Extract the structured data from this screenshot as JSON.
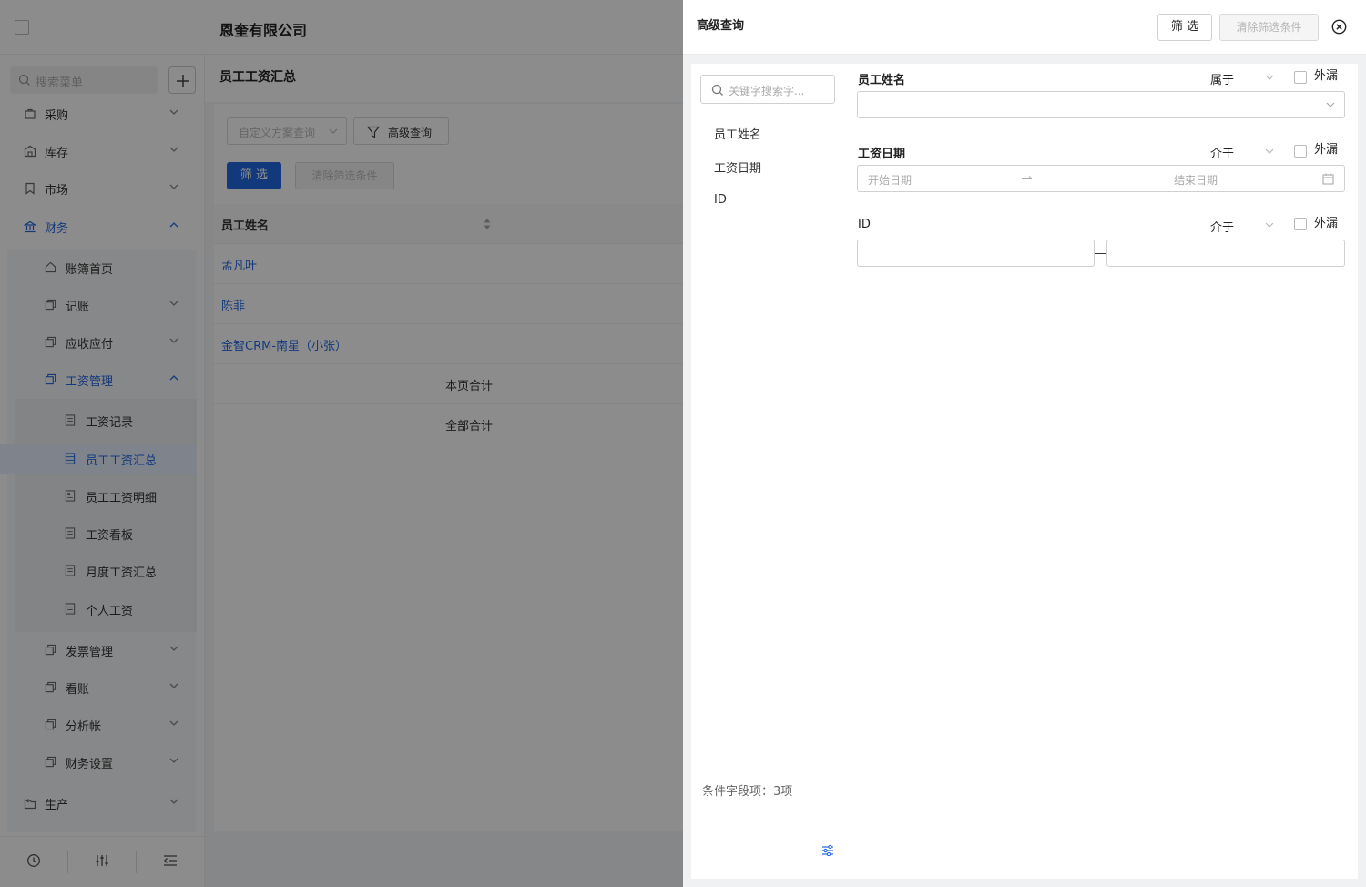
{
  "header": {
    "company": "恩奎有限公司"
  },
  "sidebar": {
    "search_placeholder": "搜索菜单",
    "items": [
      {
        "label": "采购"
      },
      {
        "label": "库存"
      },
      {
        "label": "市场"
      },
      {
        "label": "财务"
      },
      {
        "label": "账簿首页"
      },
      {
        "label": "记账"
      },
      {
        "label": "应收应付"
      },
      {
        "label": "工资管理"
      },
      {
        "label": "工资记录"
      },
      {
        "label": "员工工资汇总"
      },
      {
        "label": "员工工资明细"
      },
      {
        "label": "工资看板"
      },
      {
        "label": "月度工资汇总"
      },
      {
        "label": "个人工资"
      },
      {
        "label": "发票管理"
      },
      {
        "label": "看账"
      },
      {
        "label": "分析帐"
      },
      {
        "label": "财务设置"
      },
      {
        "label": "生产"
      }
    ]
  },
  "content": {
    "title": "员工工资汇总",
    "scheme_placeholder": "自定义方案查询",
    "advanced_query_label": "高级查询",
    "filter_label": "筛 选",
    "clear_label": "清除筛选条件",
    "table": {
      "header": "员工姓名",
      "rows": [
        "孟凡叶",
        "陈菲",
        "金智CRM-南星（小张）"
      ],
      "page_total": "本页合计",
      "all_total": "全部合计"
    }
  },
  "drawer": {
    "title": "高级查询",
    "filter_label": "筛 选",
    "clear_label": "清除筛选条件",
    "search_placeholder": "关键字搜索字...",
    "fields": [
      "员工姓名",
      "工资日期",
      "ID"
    ],
    "conditions": [
      {
        "label": "员工姓名",
        "operator": "属于",
        "exclude_label": "外漏"
      },
      {
        "label": "工资日期",
        "operator": "介于",
        "exclude_label": "外漏",
        "start_placeholder": "开始日期",
        "end_placeholder": "结束日期"
      },
      {
        "label": "ID",
        "operator": "介于",
        "exclude_label": "外漏"
      }
    ],
    "footer": "条件字段项：3项"
  }
}
